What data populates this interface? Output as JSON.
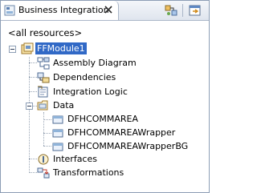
{
  "view": {
    "tab_title": "Business Integration",
    "scope_label": "<all resources>"
  },
  "tree": {
    "module": "FFModule1",
    "assembly_diagram": "Assembly Diagram",
    "dependencies": "Dependencies",
    "integration_logic": "Integration Logic",
    "data": "Data",
    "data_items": [
      "DFHCOMMAREA",
      "DFHCOMMAREAWrapper",
      "DFHCOMMAREAWrapperBG"
    ],
    "interfaces": "Interfaces",
    "transformations": "Transformations"
  },
  "colors": {
    "selection": "#3169c6",
    "frame_border": "#8c9db5"
  }
}
